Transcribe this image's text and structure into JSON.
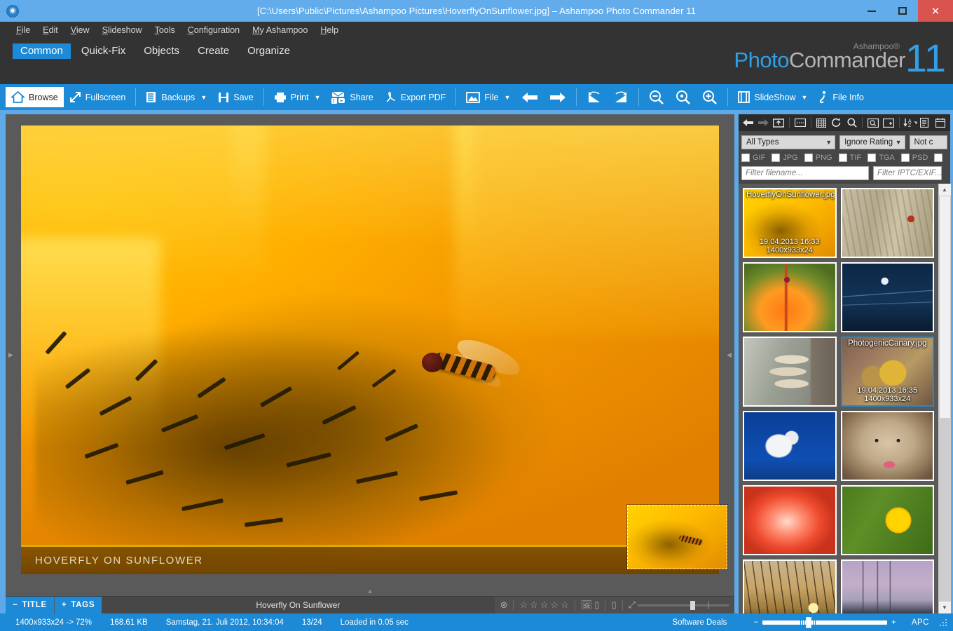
{
  "window": {
    "title": "[C:\\Users\\Public\\Pictures\\Ashampoo Pictures\\HoverflyOnSunflower.jpg] – Ashampoo Photo Commander 11",
    "app_icon": "app-logo-icon",
    "minimize_label": "Minimize",
    "maximize_label": "Maximize",
    "close_label": "✕",
    "accent_color": "#1c8ad6",
    "titlebar_color": "#63aceb",
    "close_color": "#d9534f"
  },
  "menubar": {
    "items": [
      {
        "label": "File"
      },
      {
        "label": "Edit"
      },
      {
        "label": "View"
      },
      {
        "label": "Slideshow"
      },
      {
        "label": "Tools"
      },
      {
        "label": "Configuration"
      },
      {
        "label": "My Ashampoo"
      },
      {
        "label": "Help"
      }
    ]
  },
  "tabs": {
    "items": [
      {
        "label": "Common",
        "active": true
      },
      {
        "label": "Quick-Fix",
        "active": false
      },
      {
        "label": "Objects",
        "active": false
      },
      {
        "label": "Create",
        "active": false
      },
      {
        "label": "Organize",
        "active": false
      }
    ]
  },
  "brand": {
    "superscript": "Ashampoo®",
    "name_part1": "Photo",
    "name_part2": "Commander",
    "version": "11"
  },
  "toolbar": {
    "browse": "Browse",
    "fullscreen": "Fullscreen",
    "backups": "Backups",
    "save": "Save",
    "print": "Print",
    "share": "Share",
    "export_pdf": "Export PDF",
    "file": "File",
    "slideshow": "SlideShow",
    "file_info": "File Info",
    "prev_label": "Previous image",
    "next_label": "Next image",
    "flip_h_label": "Flip horizontal",
    "flip_v_label": "Flip vertical",
    "zoom_out_label": "Zoom out",
    "zoom_fit_label": "Zoom to fit",
    "zoom_in_label": "Zoom in"
  },
  "viewer": {
    "overlay_caption": "HOVERFLY ON SUNFLOWER",
    "navigator_label": "Navigator preview"
  },
  "tagbar": {
    "title_pill": "TITLE",
    "title_pill_sign": "−",
    "tags_pill": "TAGS",
    "tags_pill_sign": "+",
    "image_title": "Hoverfly On Sunflower",
    "clear_rating_icon": "circle-x-icon",
    "stars": [
      "☆",
      "☆",
      "☆",
      "☆",
      "☆"
    ],
    "thumbnail_icon": "image-icon",
    "page_left_icon": "page-left-icon",
    "page_right_icon": "page-right-icon",
    "expand_icon": "expand-arrow-icon"
  },
  "right_panel": {
    "nav_icons": [
      {
        "name": "back-arrow-icon",
        "glyph": "←",
        "dim": false
      },
      {
        "name": "forward-arrow-icon",
        "glyph": "→",
        "dim": true
      },
      {
        "name": "folder-up-icon",
        "glyph": "▣",
        "dim": false
      },
      {
        "name": "list-view-icon",
        "glyph": "▭",
        "dim": false
      },
      {
        "name": "grid-view-icon",
        "glyph": "▦",
        "dim": false
      },
      {
        "name": "refresh-icon",
        "glyph": "↻",
        "dim": false
      },
      {
        "name": "search-icon",
        "glyph": "⌕",
        "dim": false
      },
      {
        "name": "zoom-region-icon",
        "glyph": "▣",
        "dim": false
      },
      {
        "name": "add-folder-icon",
        "glyph": "▤",
        "dim": false
      },
      {
        "name": "sort-az-icon",
        "glyph": "↓A",
        "dim": false
      },
      {
        "name": "properties-icon",
        "glyph": "▤",
        "dim": false
      },
      {
        "name": "calendar-icon",
        "glyph": "▦",
        "dim": false
      }
    ],
    "filters": {
      "type_select": "All Types",
      "rating_select": "Ignore Rating",
      "color_select": "Not c",
      "formats": [
        "GIF",
        "JPG",
        "PNG",
        "TIF",
        "TGA",
        "PSD"
      ],
      "filename_placeholder": "Filter filename...",
      "iptc_placeholder": "Filter IPTC/EXIF..."
    },
    "thumbnails": [
      {
        "filename": "HoverflyOnSunflower.jpg",
        "date": "19.04.2013 16:33",
        "dimensions": "1400x933x24",
        "selected": false,
        "labeled": true,
        "kind": "sunflower-hoverfly"
      },
      {
        "filename": "",
        "date": "",
        "dimensions": "",
        "selected": false,
        "labeled": false,
        "kind": "ladybug-grass"
      },
      {
        "filename": "",
        "date": "",
        "dimensions": "",
        "selected": false,
        "labeled": false,
        "kind": "orange-lily"
      },
      {
        "filename": "",
        "date": "",
        "dimensions": "",
        "selected": false,
        "labeled": false,
        "kind": "moon-night"
      },
      {
        "filename": "",
        "date": "",
        "dimensions": "",
        "selected": false,
        "labeled": false,
        "kind": "tree-mushrooms"
      },
      {
        "filename": "PhotogenicCanary.jpg",
        "date": "19.04.2013 16:35",
        "dimensions": "1400x933x24",
        "selected": true,
        "labeled": true,
        "kind": "canary"
      },
      {
        "filename": "",
        "date": "",
        "dimensions": "",
        "selected": false,
        "labeled": false,
        "kind": "dove-sky"
      },
      {
        "filename": "",
        "date": "",
        "dimensions": "",
        "selected": false,
        "labeled": false,
        "kind": "dog"
      },
      {
        "filename": "",
        "date": "",
        "dimensions": "",
        "selected": false,
        "labeled": false,
        "kind": "rose"
      },
      {
        "filename": "",
        "date": "",
        "dimensions": "",
        "selected": false,
        "labeled": false,
        "kind": "sunflower"
      },
      {
        "filename": "",
        "date": "",
        "dimensions": "",
        "selected": false,
        "labeled": false,
        "kind": "sunset-grass"
      },
      {
        "filename": "",
        "date": "",
        "dimensions": "",
        "selected": false,
        "labeled": false,
        "kind": "windturbines"
      }
    ]
  },
  "statusbar": {
    "dimensions_zoom": "1400x933x24 -> 72%",
    "filesize": "168.61 KB",
    "datetime": "Samstag, 21. Juli 2012, 10:34:04",
    "index": "13/24",
    "load_time": "Loaded in 0.05 sec",
    "deals": "Software Deals",
    "zoom_minus": "−",
    "zoom_plus": "+",
    "apc": "APC"
  }
}
